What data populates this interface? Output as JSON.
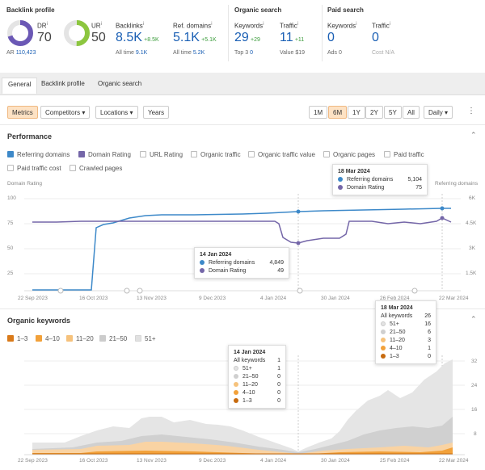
{
  "backlink_profile": {
    "title": "Backlink profile",
    "dr": {
      "label": "DR",
      "value": "70",
      "ar_label": "AR",
      "ar_value": "110,423",
      "fill": 0.7
    },
    "ur": {
      "label": "UR",
      "value": "50",
      "fill": 0.5
    },
    "backlinks": {
      "label": "Backlinks",
      "value": "8.5K",
      "delta": "+8.5K",
      "alltime_label": "All time",
      "alltime_value": "9.1K"
    },
    "ref_domains": {
      "label": "Ref. domains",
      "value": "5.1K",
      "delta": "+5.1K",
      "alltime_label": "All time",
      "alltime_value": "5.2K"
    }
  },
  "organic_search": {
    "title": "Organic search",
    "keywords": {
      "label": "Keywords",
      "value": "29",
      "delta": "+29",
      "sub_label": "Top 3",
      "sub_value": "0"
    },
    "traffic": {
      "label": "Traffic",
      "value": "11",
      "delta": "+11",
      "sub_label": "Value",
      "sub_value": "$19"
    }
  },
  "paid_search": {
    "title": "Paid search",
    "keywords": {
      "label": "Keywords",
      "value": "0",
      "sub_label": "Ads",
      "sub_value": "0"
    },
    "traffic": {
      "label": "Traffic",
      "value": "0",
      "sub_label": "Cost",
      "sub_value": "N/A"
    }
  },
  "tabs": [
    "General",
    "Backlink profile",
    "Organic search"
  ],
  "toolbar": {
    "metrics": "Metrics",
    "competitors": "Competitors",
    "locations": "Locations",
    "years": "Years",
    "ranges": [
      "1M",
      "6M",
      "1Y",
      "2Y",
      "5Y",
      "All"
    ],
    "active_range": "6M",
    "interval": "Daily"
  },
  "performance": {
    "title": "Performance",
    "checks": [
      "Referring domains",
      "Domain Rating",
      "URL Rating",
      "Organic traffic",
      "Organic traffic value",
      "Organic pages",
      "Paid traffic",
      "Paid traffic cost",
      "Crawled pages"
    ],
    "left_axis_title": "Domain Rating",
    "right_axis_title": "Referring domains",
    "left_ticks": [
      "100",
      "75",
      "50",
      "25"
    ],
    "right_ticks": [
      "6K",
      "4.5K",
      "3K",
      "1.5K"
    ],
    "x_ticks": [
      "22 Sep 2023",
      "16 Oct 2023",
      "13 Nov 2023",
      "9 Dec 2023",
      "4 Jan 2024",
      "30 Jan 2024",
      "26 Feb 2024",
      "22 Mar 2024"
    ],
    "tooltip_mar": {
      "date": "18 Mar 2024",
      "rows": [
        {
          "label": "Referring domains",
          "value": "5,104"
        },
        {
          "label": "Domain Rating",
          "value": "75"
        }
      ]
    },
    "tooltip_jan": {
      "date": "14 Jan 2024",
      "rows": [
        {
          "label": "Referring domains",
          "value": "4,849"
        },
        {
          "label": "Domain Rating",
          "value": "49"
        }
      ]
    }
  },
  "organic_keywords": {
    "title": "Organic keywords",
    "legend": [
      "1–3",
      "4–10",
      "11–20",
      "21–50",
      "51+"
    ],
    "right_ticks": [
      "32",
      "24",
      "16",
      "8"
    ],
    "x_ticks": [
      "22 Sep 2023",
      "16 Oct 2023",
      "13 Nov 2023",
      "9 Dec 2023",
      "4 Jan 2024",
      "30 Jan 2024",
      "25 Feb 2024",
      "22 Mar 2024"
    ],
    "tooltip_mar": {
      "date": "18 Mar 2024",
      "all_label": "All keywords",
      "all_value": "26",
      "rows": [
        {
          "label": "51+",
          "value": "16"
        },
        {
          "label": "21–50",
          "value": "6"
        },
        {
          "label": "11–20",
          "value": "3"
        },
        {
          "label": "4–10",
          "value": "1"
        },
        {
          "label": "1–3",
          "value": "0"
        }
      ]
    },
    "tooltip_jan": {
      "date": "14 Jan 2024",
      "all_label": "All keywords",
      "all_value": "1",
      "rows": [
        {
          "label": "51+",
          "value": "1"
        },
        {
          "label": "21–50",
          "value": "0"
        },
        {
          "label": "11–20",
          "value": "0"
        },
        {
          "label": "4–10",
          "value": "0"
        },
        {
          "label": "1–3",
          "value": "0"
        }
      ]
    }
  },
  "colors": {
    "blue": "#3d89c9",
    "purple": "#7466a8",
    "o1": "#c76a0e",
    "o2": "#f2a13a",
    "o3": "#f6c27c",
    "g1": "#cfcfcf",
    "g2": "#e3e3e3"
  }
}
